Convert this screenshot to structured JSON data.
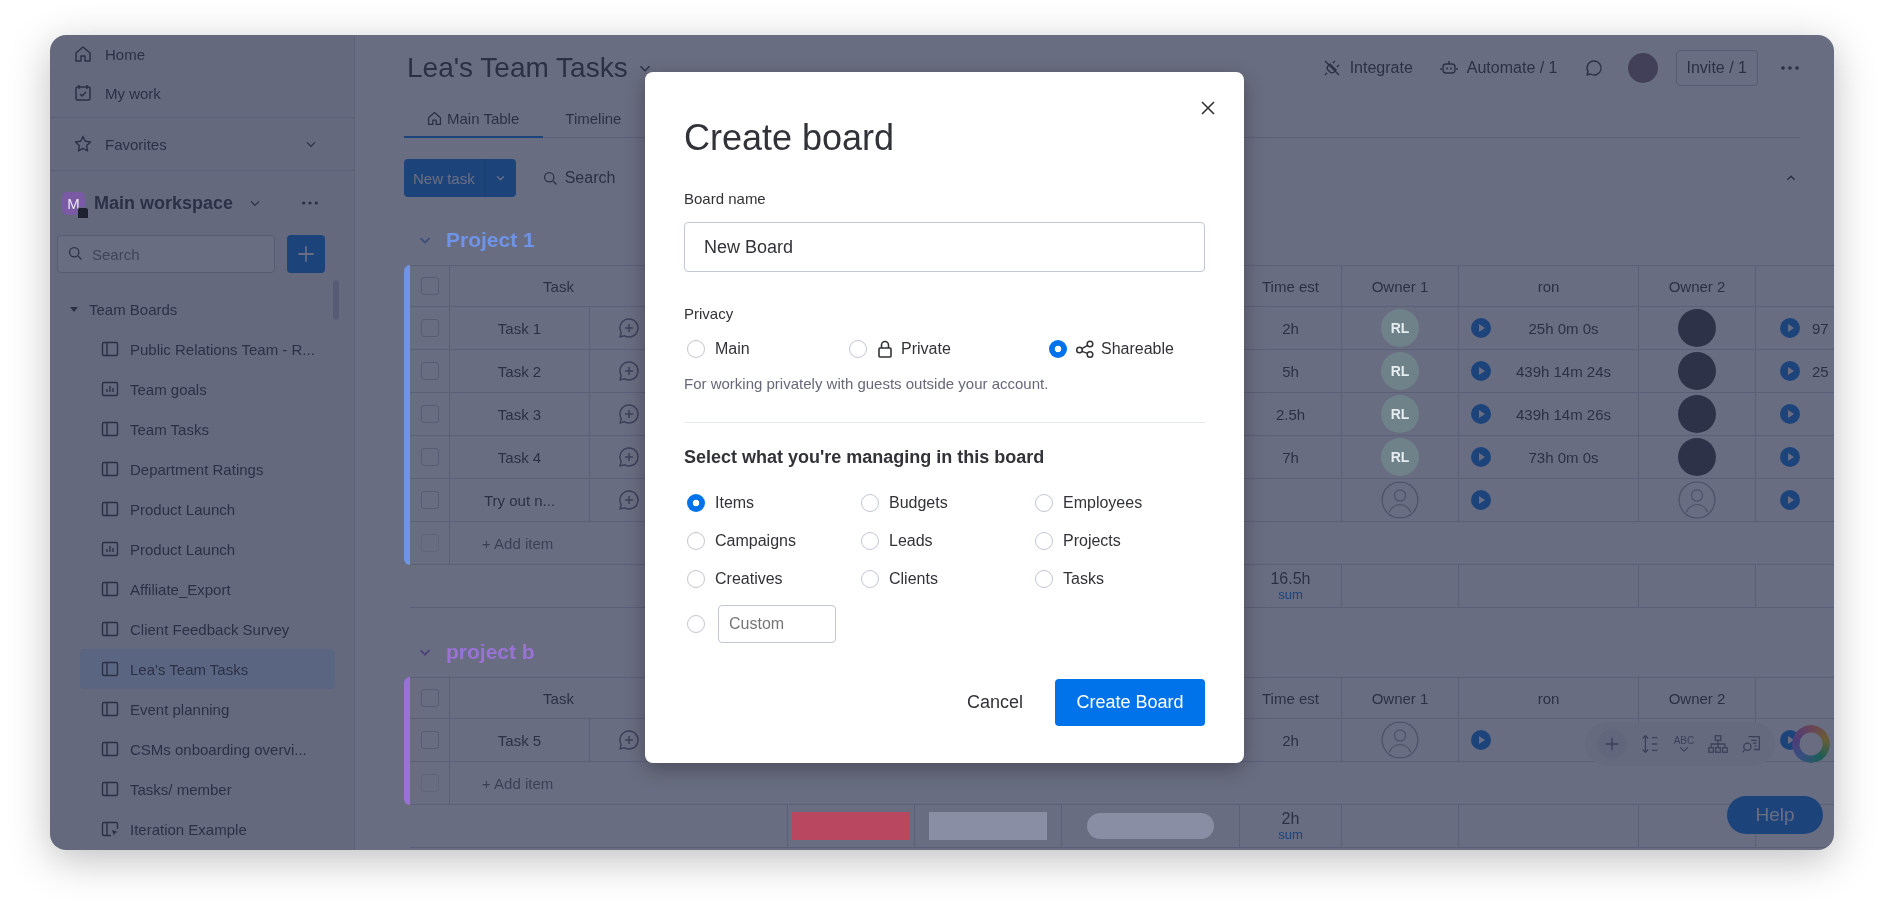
{
  "sidebar": {
    "nav": [
      {
        "label": "Home",
        "kind": "home"
      },
      {
        "label": "My work",
        "kind": "my-work"
      }
    ],
    "favorites": {
      "label": "Favorites",
      "expanded": false
    },
    "workspace": {
      "badge": "M",
      "name": "Main workspace"
    },
    "search": {
      "placeholder": "Search"
    },
    "folder": {
      "label": "Team Boards",
      "expanded": true,
      "children": [
        {
          "label": "Public Relations Team - R...",
          "kind": "board",
          "selected": false
        },
        {
          "label": "Team goals",
          "kind": "dashboard",
          "selected": false
        },
        {
          "label": "Team Tasks",
          "kind": "board",
          "selected": false
        },
        {
          "label": "Department Ratings",
          "kind": "board",
          "selected": false
        },
        {
          "label": "Product Launch",
          "kind": "board",
          "selected": false
        },
        {
          "label": "Product Launch",
          "kind": "dashboard",
          "selected": false
        },
        {
          "label": "Affiliate_Export",
          "kind": "board",
          "selected": false
        },
        {
          "label": "Client Feedback Survey",
          "kind": "board",
          "selected": false
        },
        {
          "label": "Lea's Team Tasks",
          "kind": "board",
          "selected": true
        },
        {
          "label": "Event planning",
          "kind": "board",
          "selected": false
        },
        {
          "label": "CSMs onboarding overvi...",
          "kind": "board",
          "selected": false
        },
        {
          "label": "Tasks/ member",
          "kind": "board",
          "selected": false
        },
        {
          "label": "Iteration Example",
          "kind": "workflow",
          "selected": false
        }
      ]
    }
  },
  "board": {
    "title": "Lea's Team Tasks",
    "actions": [
      {
        "label": "Integrate",
        "kind": "integrate"
      },
      {
        "label": "Automate / 1",
        "kind": "automate"
      }
    ],
    "invite": "Invite / 1",
    "tabs": [
      {
        "label": "Main Table",
        "selected": true
      },
      {
        "label": "Timeline",
        "selected": false
      }
    ],
    "new_task": "New task",
    "search": "Search",
    "groups": [
      {
        "name": "Project 1",
        "color": "#6f93e6",
        "header": {
          "checked": false,
          "task": "Task",
          "time_est": "Time est",
          "owner_1": "Owner 1",
          "ron": "ron",
          "owner_2": "Owner 2"
        },
        "rows": [
          {
            "checked": false,
            "task": "Task 1",
            "time_est": "2h",
            "owner_1": {
              "kind": "initials",
              "initials": "RL"
            },
            "ron": "25h 0m 0s",
            "owner_2": {
              "kind": "photo"
            },
            "extra": "97"
          },
          {
            "checked": false,
            "task": "Task 2",
            "time_est": "5h",
            "owner_1": {
              "kind": "initials",
              "initials": "RL"
            },
            "ron": "439h 14m 24s",
            "owner_2": {
              "kind": "photo"
            },
            "extra": "25"
          },
          {
            "checked": false,
            "task": "Task 3",
            "time_est": "2.5h",
            "owner_1": {
              "kind": "initials",
              "initials": "RL"
            },
            "ron": "439h 14m 26s",
            "owner_2": {
              "kind": "photo"
            }
          },
          {
            "checked": false,
            "task": "Task 4",
            "time_est": "7h",
            "owner_1": {
              "kind": "initials",
              "initials": "RL"
            },
            "ron": "73h 0m 0s",
            "owner_2": {
              "kind": "photo"
            }
          },
          {
            "checked": false,
            "task": "Try out n...",
            "owner_1": {
              "kind": "empty"
            },
            "owner_2": {
              "kind": "empty"
            }
          }
        ],
        "add_item": {
          "label": "+ Add item",
          "checked": false
        },
        "sum": {
          "value": "16.5h",
          "label": "sum"
        }
      },
      {
        "name": "project b",
        "color": "#9a72d6",
        "header": {
          "checked": false,
          "task": "Task",
          "time_est": "Time est",
          "owner_1": "Owner 1",
          "ron": "ron",
          "owner_2": "Owner 2"
        },
        "rows": [
          {
            "checked": false,
            "task": "Task 5",
            "time_est": "2h",
            "owner_1": {
              "kind": "empty"
            }
          }
        ],
        "add_item": {
          "label": "+ Add item",
          "checked": false
        },
        "sum": {
          "value": "2h",
          "label": "sum"
        },
        "status_summary": [
          {
            "kind": "bar",
            "color": "#b8475f"
          },
          {
            "kind": "bar",
            "color": "#8a8ea4"
          },
          {
            "kind": "pill",
            "color": "#8a8ea4"
          }
        ]
      }
    ]
  },
  "floating_toolbar": {
    "spellcheck_text": "ABC"
  },
  "help": "Help",
  "dialog": {
    "title": "Create board",
    "name_label": "Board name",
    "name_value": "New Board",
    "privacy_label": "Privacy",
    "privacy_options": [
      {
        "label": "Main",
        "kind": "plain",
        "selected": false
      },
      {
        "label": "Private",
        "kind": "lock",
        "selected": false
      },
      {
        "label": "Shareable",
        "kind": "share",
        "selected": true
      }
    ],
    "privacy_hint": "For working privately with guests outside your account.",
    "manage_heading": "Select what you're managing in this board",
    "manage_options": [
      {
        "label": "Items",
        "selected": true
      },
      {
        "label": "Budgets",
        "selected": false
      },
      {
        "label": "Employees",
        "selected": false
      },
      {
        "label": "Campaigns",
        "selected": false
      },
      {
        "label": "Leads",
        "selected": false
      },
      {
        "label": "Projects",
        "selected": false
      },
      {
        "label": "Creatives",
        "selected": false
      },
      {
        "label": "Clients",
        "selected": false
      },
      {
        "label": "Tasks",
        "selected": false
      }
    ],
    "custom": {
      "placeholder": "Custom",
      "selected": false
    },
    "cancel": "Cancel",
    "submit": "Create Board"
  }
}
